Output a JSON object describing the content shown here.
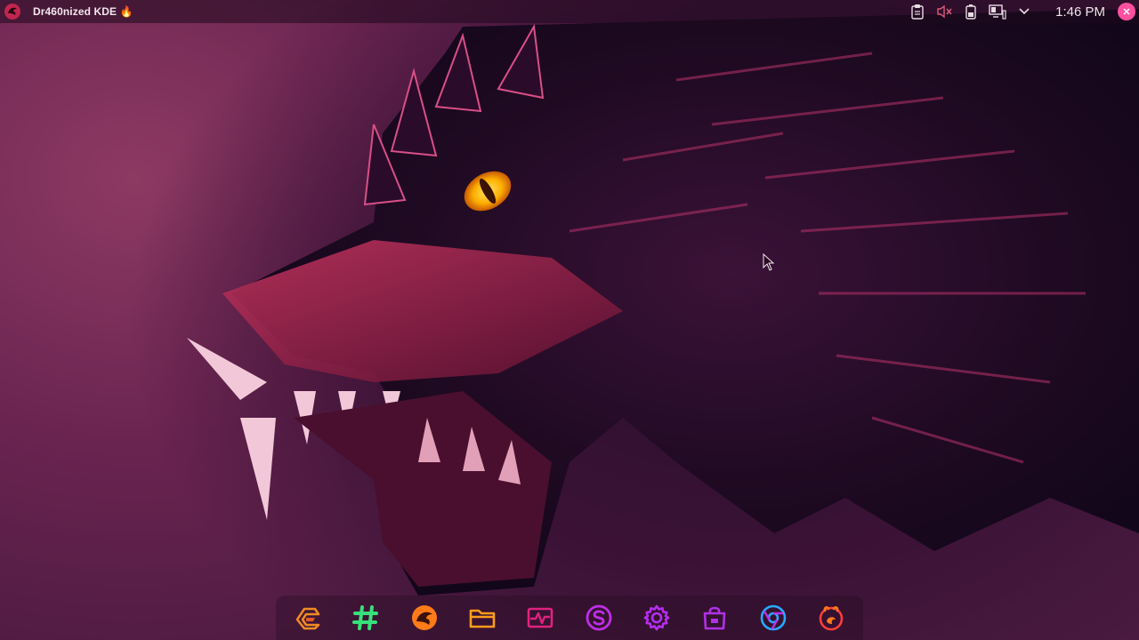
{
  "panel": {
    "launcher_icon": "dragon-logo-icon",
    "window_title": "Dr460nized KDE",
    "title_suffix_icon": "fire-icon",
    "tray_icons": [
      "clipboard-icon",
      "volume-muted-icon",
      "battery-icon",
      "display-configuration-icon",
      "expand-tray-chevron-icon"
    ],
    "clock": "1:46 PM",
    "user_icon": "user-avatar-icon"
  },
  "wallpaper": {
    "subject": "dragon-wallpaper-image",
    "accent": "#ffb000",
    "background": "#7b2d58"
  },
  "dock": {
    "apps": [
      {
        "icon": "garuda-logo-icon",
        "color": "#f08a24"
      },
      {
        "icon": "hashtag-icon",
        "color": "#37e07a"
      },
      {
        "icon": "dragon-app-icon",
        "color": "#ff7a18"
      },
      {
        "icon": "folder-icon",
        "color": "#ff9c1a"
      },
      {
        "icon": "system-monitor-icon",
        "color": "#e0227f"
      },
      {
        "icon": "software-s-icon",
        "color": "#c02ee8"
      },
      {
        "icon": "settings-gear-icon",
        "color": "#b42ef0"
      },
      {
        "icon": "store-bag-icon",
        "color": "#b030e8"
      },
      {
        "icon": "chromium-browser-icon",
        "color": "#2aa8ff"
      },
      {
        "icon": "firedragon-browser-icon",
        "color": "#ff3d3d"
      }
    ]
  }
}
